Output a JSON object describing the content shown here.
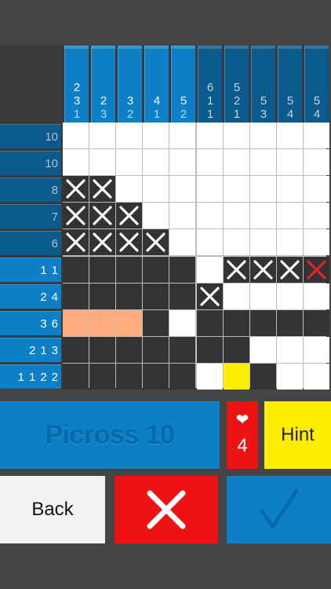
{
  "app": {
    "title": "Picross 10",
    "hint_label": "Hint",
    "back_label": "Back",
    "lives": "4"
  },
  "colors": {
    "clue_light": "#0d7fc6",
    "clue_dark": "#0a5a8e",
    "filled": "#333333",
    "cross_mark": "#ffffff",
    "error_mark": "#e12525",
    "highlight_orange": "#ffab7f",
    "highlight_yellow": "#ffee00"
  },
  "column_clues": [
    [
      "2",
      "3",
      "1"
    ],
    [
      "2",
      "3"
    ],
    [
      "3",
      "2"
    ],
    [
      "4",
      "1"
    ],
    [
      "5",
      "2"
    ],
    [
      "6",
      "1",
      "1"
    ],
    [
      "5",
      "2",
      "1"
    ],
    [
      "5",
      "3"
    ],
    [
      "5",
      "4"
    ],
    [
      "5",
      "4"
    ]
  ],
  "row_clues": [
    [
      "10"
    ],
    [
      "10"
    ],
    [
      "8"
    ],
    [
      "7"
    ],
    [
      "6"
    ],
    [
      "1",
      "1"
    ],
    [
      "2",
      "4"
    ],
    [
      "3",
      "6"
    ],
    [
      "2",
      "1",
      "3"
    ],
    [
      "1",
      "1",
      "2",
      "2"
    ]
  ],
  "grid": [
    [
      "E",
      "E",
      "E",
      "E",
      "E",
      "E",
      "E",
      "E",
      "E",
      "E"
    ],
    [
      "E",
      "E",
      "E",
      "E",
      "E",
      "E",
      "E",
      "E",
      "E",
      "E"
    ],
    [
      "X",
      "X",
      "E",
      "E",
      "E",
      "E",
      "E",
      "E",
      "E",
      "E"
    ],
    [
      "X",
      "X",
      "X",
      "E",
      "E",
      "E",
      "E",
      "E",
      "E",
      "E"
    ],
    [
      "X",
      "X",
      "X",
      "X",
      "E",
      "E",
      "E",
      "E",
      "E",
      "E"
    ],
    [
      "F",
      "F",
      "F",
      "F",
      "F",
      "E",
      "X",
      "X",
      "X",
      "R"
    ],
    [
      "F",
      "F",
      "F",
      "F",
      "F",
      "X",
      "E",
      "E",
      "E",
      "E"
    ],
    [
      "O",
      "O",
      "O",
      "F",
      "E",
      "F",
      "F",
      "F",
      "F",
      "F"
    ],
    [
      "F",
      "F",
      "F",
      "F",
      "F",
      "F",
      "F",
      "E",
      "E",
      "E"
    ],
    [
      "F",
      "F",
      "F",
      "F",
      "F",
      "E",
      "Y",
      "F",
      "E",
      "E"
    ]
  ]
}
